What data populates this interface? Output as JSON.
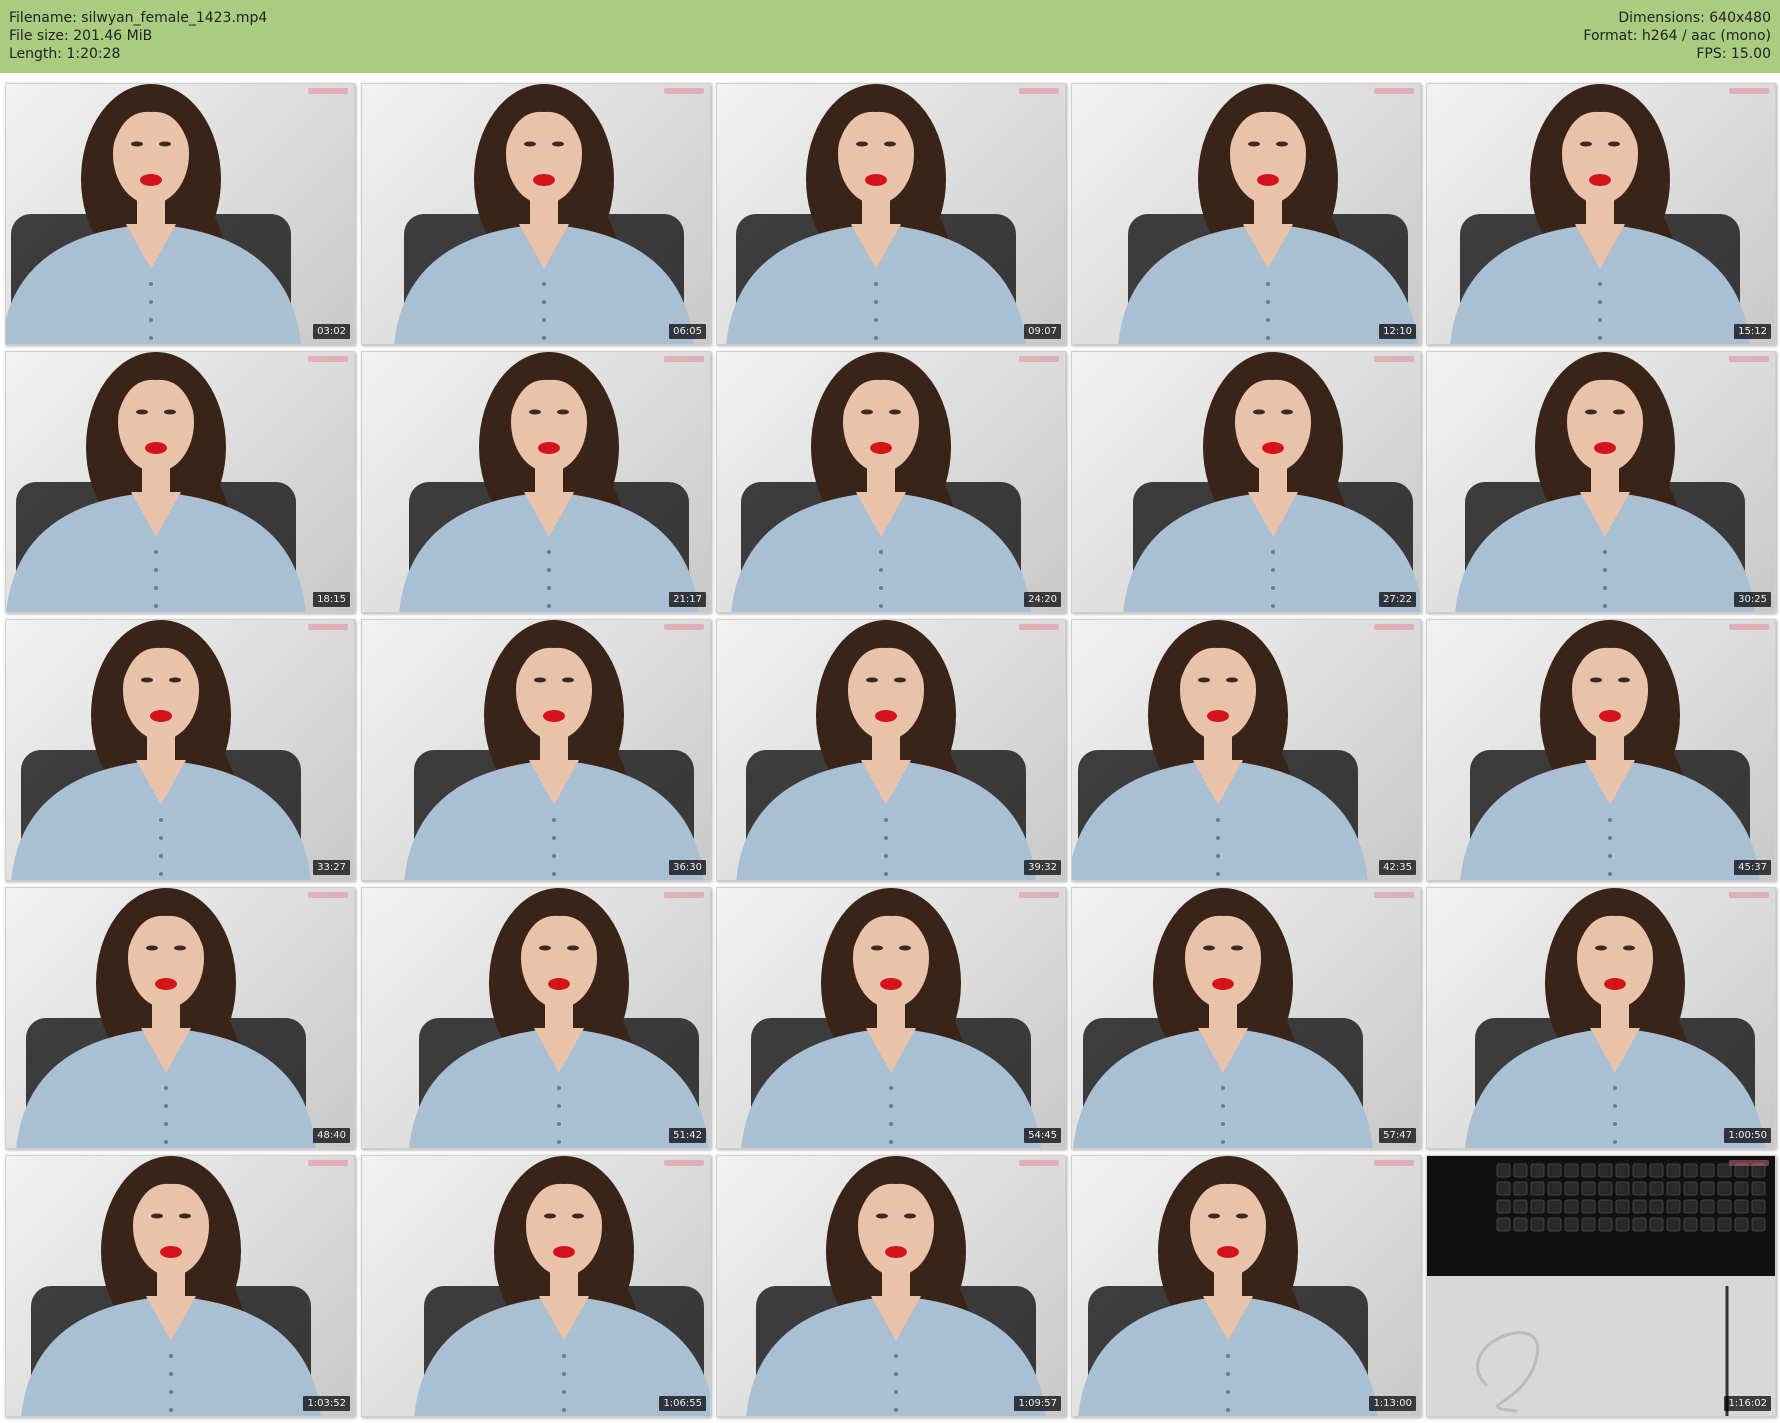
{
  "header": {
    "filename_label": "Filename: silwyan_female_1423.mp4",
    "filesize_label": "File size: 201.46 MiB",
    "length_label": "Length: 1:20:28",
    "dimensions_label": "Dimensions: 640x480",
    "format_label": "Format: h264 / aac (mono)",
    "fps_label": "FPS: 15.00"
  },
  "colors": {
    "header_bg": "#aacc80",
    "shirt": "#a9bfd3",
    "hair": "#3a2418",
    "lips": "#d4141a",
    "skin": "#e9c2aa"
  },
  "thumbnails": [
    {
      "timestamp": "03:02"
    },
    {
      "timestamp": "06:05"
    },
    {
      "timestamp": "09:07"
    },
    {
      "timestamp": "12:10"
    },
    {
      "timestamp": "15:12"
    },
    {
      "timestamp": "18:15"
    },
    {
      "timestamp": "21:17"
    },
    {
      "timestamp": "24:20"
    },
    {
      "timestamp": "27:22"
    },
    {
      "timestamp": "30:25"
    },
    {
      "timestamp": "33:27"
    },
    {
      "timestamp": "36:30"
    },
    {
      "timestamp": "39:32"
    },
    {
      "timestamp": "42:35"
    },
    {
      "timestamp": "45:37"
    },
    {
      "timestamp": "48:40"
    },
    {
      "timestamp": "51:42"
    },
    {
      "timestamp": "54:45"
    },
    {
      "timestamp": "57:47"
    },
    {
      "timestamp": "1:00:50"
    },
    {
      "timestamp": "1:03:52"
    },
    {
      "timestamp": "1:06:55"
    },
    {
      "timestamp": "1:09:57"
    },
    {
      "timestamp": "1:13:00"
    },
    {
      "timestamp": "1:16:02"
    }
  ]
}
